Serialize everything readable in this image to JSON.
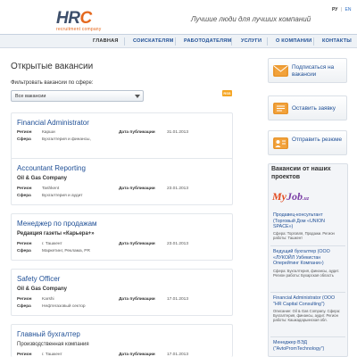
{
  "header": {
    "logo_main": "HRC",
    "logo_sub": "recruitment company",
    "slogan": "Лучшие люди для лучших компаний",
    "lang_ru": "РУ",
    "lang_sep": "|",
    "lang_en": "EN"
  },
  "nav": {
    "items": [
      "ГЛАВНАЯ",
      "СОИСКАТЕЛЯМ",
      "РАБОТОДАТЕЛЯМ",
      "УСЛУГИ",
      "О КОМПАНИИ",
      "КОНТАКТЫ"
    ]
  },
  "main": {
    "title": "Открытые вакансии",
    "filter_label": "Фильтровать вакансии по сфере:",
    "filter_value": "Все вакансии",
    "rss_label": "RSS",
    "labels": {
      "region": "Регион",
      "sphere": "Сфера",
      "date": "Дата публикации"
    },
    "vacancies": [
      {
        "title": "Financial Administrator",
        "company": "",
        "region": "Карши",
        "sphere": "Бухгалтерия и финансы,",
        "date": "31.01.2013"
      },
      {
        "title": "Accountant Reporting",
        "company": "Oil & Gas Company",
        "region": "Tashkent",
        "sphere": "Бухгалтерия и аудит",
        "date": "23.01.2013"
      },
      {
        "title": "Менеджер по продажам",
        "company": "Редакция газеты «Карьера+»",
        "region": "г. Ташкент",
        "sphere": "Маркетинг, Реклама, PR",
        "date": "23.01.2013"
      },
      {
        "title": "Safety Officer",
        "company": "Oil & Gas Company",
        "region": "Karshi",
        "sphere": "Нефтегазовый сектор",
        "date": "17.01.2013"
      },
      {
        "title": "Главный бухгалтер",
        "company": "Производственная компания",
        "region": "г. Ташкент",
        "sphere": "Бухгалтерия и аудит",
        "date": "17.01.2013"
      }
    ]
  },
  "sidebar": {
    "btn_subscribe": "Подписаться на вакансии",
    "btn_apply": "Оставить заявку",
    "btn_resume": "Отправить резюме",
    "panel_title": "Вакансии от наших проектов",
    "myjob_logo": "MyJob",
    "items": [
      {
        "title": "Продавец-консультант (Торговый Дом «UNION SPACE»)",
        "meta": "Сфера: Торговля, Продажи. Регион работы: Ташкент"
      },
      {
        "title": "Ведущий бухгалтер (ООО «ЛУКОЙЛ Узбекистан Оперейтинг Компани»)",
        "meta": "Сфера: Бухгалтерия, финансы, аудит. Регион работы: Бухарская область"
      },
      {
        "title": "Financial Administrator (ООО \"HR Capital Consulting\")",
        "meta": "Описание: Oil & Gas Company. Сфера: Бухгалтерия, финансы, аудит. Регион работы: Кашкадарьинская обл."
      },
      {
        "title": "Менеджер ВЭД (\"AvtoPromTechnology\")",
        "meta": ""
      }
    ]
  },
  "colors": {
    "accent_orange": "#e4681e",
    "link_blue": "#1f4f96",
    "icon_orange": "#f2a23b"
  }
}
